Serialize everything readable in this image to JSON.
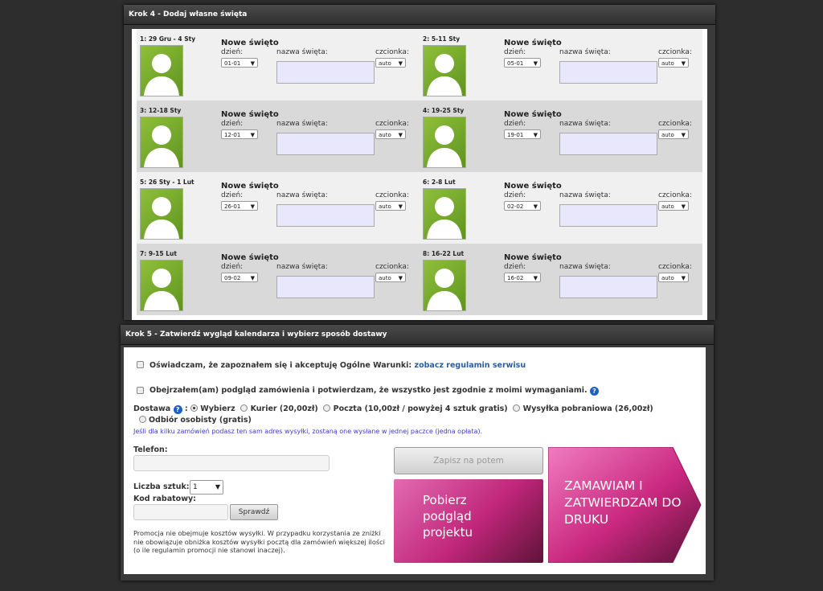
{
  "step4": {
    "header": "Krok 4 - Dodaj własne święta",
    "cells": [
      {
        "week": "1: 29 Gru - 4 Sty",
        "title": "Nowe święto",
        "day": "01-01"
      },
      {
        "week": "2: 5-11 Sty",
        "title": "Nowe święto",
        "day": "05-01"
      },
      {
        "week": "3: 12-18 Sty",
        "title": "Nowe święto",
        "day": "12-01"
      },
      {
        "week": "4: 19-25 Sty",
        "title": "Nowe święto",
        "day": "19-01"
      },
      {
        "week": "5: 26 Sty - 1 Lut",
        "title": "Nowe święto",
        "day": "26-01"
      },
      {
        "week": "6: 2-8 Lut",
        "title": "Nowe święto",
        "day": "02-02"
      },
      {
        "week": "7: 9-15 Lut",
        "title": "Nowe święto",
        "day": "09-02"
      },
      {
        "week": "8: 16-22 Lut",
        "title": "Nowe święto",
        "day": "16-02"
      }
    ],
    "labels": {
      "day": "dzień:",
      "name": "nazwa święta:",
      "font": "czcionka:",
      "font_value": "auto"
    }
  },
  "step5": {
    "header": "Krok 5 - Zatwierdź wygląd kalendarza i wybierz sposób dostawy",
    "terms_text": "Oświadczam, że zapoznałem się i akceptuję Ogólne Warunki:",
    "terms_link": "zobacz regulamin serwisu",
    "reviewed_text": "Obejrzałem(am) podgląd zamówienia i potwierdzam, że wszystko jest zgodnie z moimi wymaganiami.",
    "delivery_label": "Dostawa",
    "delivery_options": [
      "Wybierz",
      "Kurier (20,00zł)",
      "Poczta (10,00zł / powyżej 4 sztuk gratis)",
      "Wysyłka pobraniowa (26,00zł)",
      "Odbiór osobisty (gratis)"
    ],
    "delivery_note": "Jeśli dla kilku zamówień podasz ten sam adres wysyłki, zostaną one wysłane w jednej paczce (jedna opłata).",
    "phone_label": "Telefon:",
    "qty_label": "Liczba sztuk:",
    "qty_value": "1",
    "code_label": "Kod rabatowy:",
    "check_button": "Sprawdź",
    "promo_note": "Promocja nie obejmuje kosztów wysyłki. W przypadku korzystania ze zniżki nie obowiązuje obniżka kosztów wysyłki pocztą dla zamówień większej ilości (o ile regulamin promocji nie stanowi inaczej).",
    "save_later": "Zapisz na potem",
    "download_preview": "Pobierz podgląd projektu",
    "order_button": "ZAMAWIAM I ZATWIERDZAM DO DRUKU",
    "colors": {
      "accent": "#c0267a",
      "link": "#2a5d9f"
    }
  }
}
